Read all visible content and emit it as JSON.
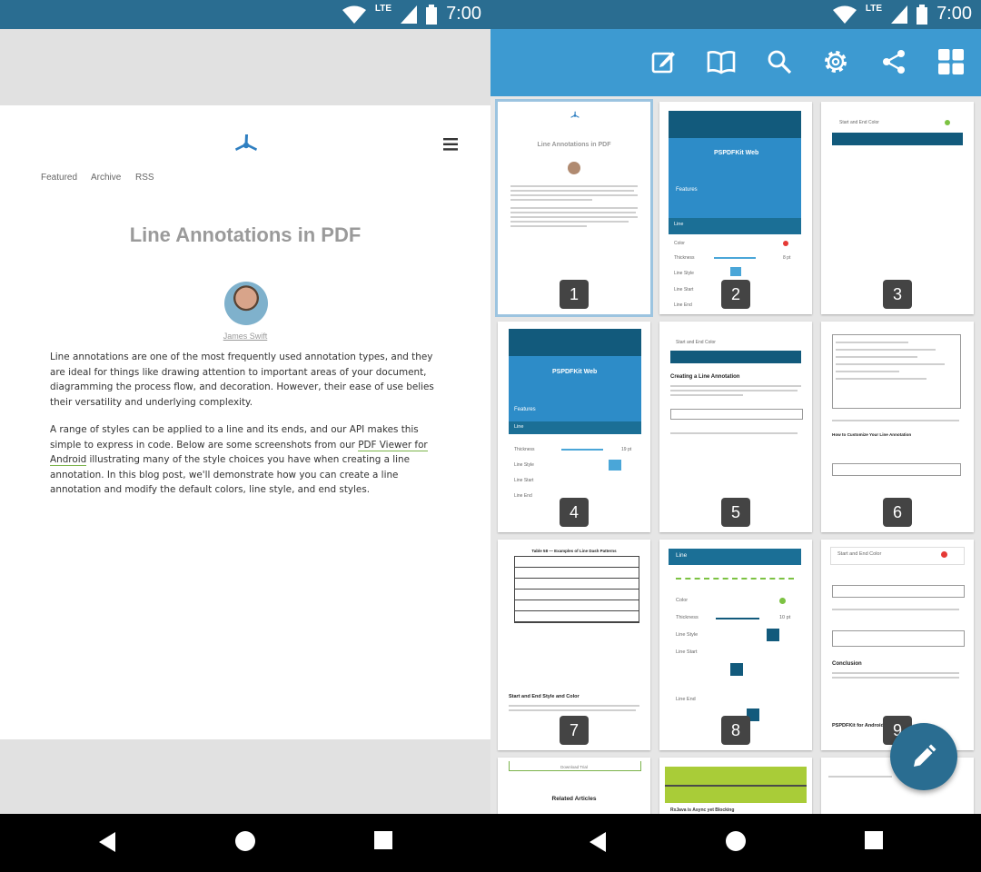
{
  "status": {
    "network": "LTE",
    "time_left": "7:00",
    "time_right": "7:00"
  },
  "blog": {
    "nav": [
      "Featured",
      "Archive",
      "RSS"
    ],
    "title": "Line Annotations in PDF",
    "author": "James Swift",
    "para1": "Line annotations are one of the most frequently used annotation types, and they are ideal for things like drawing attention to important areas of your document, diagramming the process flow, and decoration. However, their ease of use belies their versatility and underlying complexity.",
    "para2_before": "A range of styles can be applied to a line and its ends, and our API makes this simple to express in code. Below are some screenshots from our ",
    "para2_link": "PDF Viewer for Android",
    "para2_after": " illustrating many of the style choices you have when creating a line annotation. In this blog post, we'll demonstrate how you can create a line annotation and modify the default colors, line style, and end styles."
  },
  "toolbar": {
    "icons": [
      "annotate-icon",
      "outline-icon",
      "search-icon",
      "settings-icon",
      "share-icon",
      "thumbnail-grid-icon"
    ]
  },
  "thumbnails": {
    "pages": [
      "1",
      "2",
      "3",
      "4",
      "5",
      "6",
      "7",
      "8",
      "9"
    ],
    "p1_title": "Line Annotations in PDF",
    "p2_brand": "PSPDFKit Web",
    "p2_features": "Features",
    "p2_sheet": "Line",
    "p2_color": "Color",
    "p2_thickness": "Thickness",
    "p2_thick_val": "8 pt",
    "p2_style": "Line Style",
    "p2_start": "Line Start",
    "p2_end": "Line End",
    "p3_label": "Start and End Color",
    "p4_brand": "PSPDFKit Web",
    "p4_features": "Features",
    "p4_sheet": "Line",
    "p4_thickness": "Thickness",
    "p4_thick_val": "19 pt",
    "p4_style": "Line Style",
    "p4_start": "Line Start",
    "p4_end": "Line End",
    "p5_label": "Start and End Color",
    "p5_heading": "Creating a Line Annotation",
    "p6_heading": "How to Customize Your Line Annotation",
    "p7_table": "Table 58 — Examples of Line Dash Patterns",
    "p7_heading": "Start and End Style and Color",
    "p8_sheet": "Line",
    "p8_color": "Color",
    "p8_thickness": "Thickness",
    "p8_thick_val": "10 pt",
    "p8_style": "Line Style",
    "p8_start": "Line Start",
    "p8_end": "Line End",
    "p9_label": "Start and End Color",
    "p9_conclusion": "Conclusion",
    "p9_footer": "PSPDFKit for Android",
    "p10_trial": "Download Trial",
    "p10_related": "Related Articles",
    "p11_caption": "RxJava is Async yet Blocking"
  },
  "colors": {
    "status_bar": "#2a6d91",
    "toolbar": "#3d9ad1",
    "fab": "#2a6d91",
    "link_underline": "#7bb34a"
  }
}
